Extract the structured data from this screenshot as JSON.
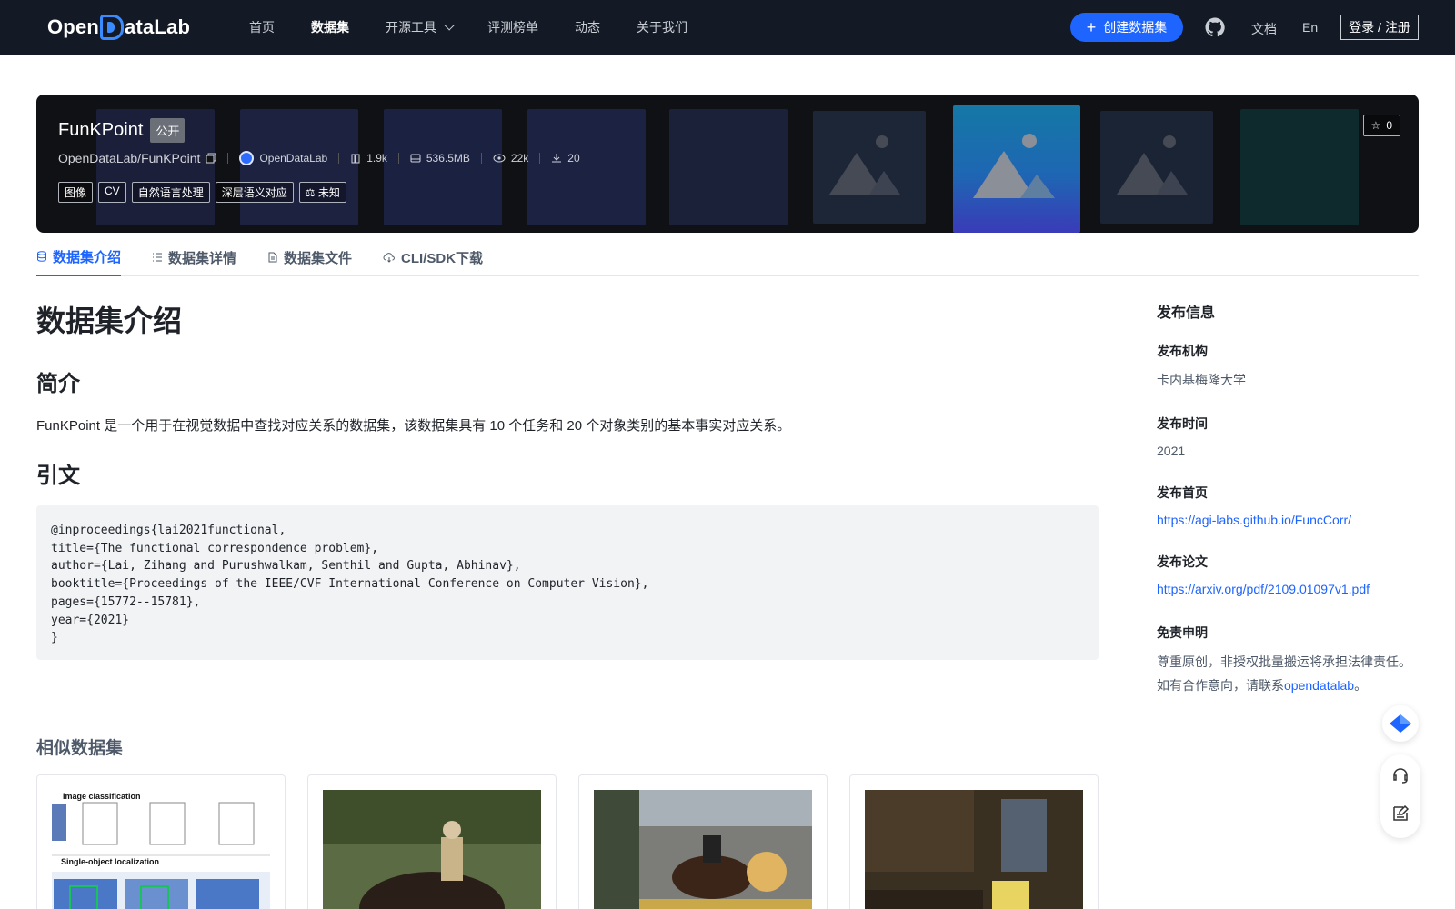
{
  "nav": {
    "logo_text_left": "Open",
    "logo_text_right": "ataLab",
    "links": [
      "首页",
      "数据集",
      "开源工具",
      "评测榜单",
      "动态",
      "关于我们"
    ],
    "create_label": "创建数据集",
    "doc_label": "文档",
    "lang_label": "En",
    "login_label": "登录 / 注册"
  },
  "dataset": {
    "name": "FunKPoint",
    "visibility": "公开",
    "path": "OpenDataLab/FunKPoint",
    "org": "OpenDataLab",
    "papers": "1.9k",
    "size": "536.5MB",
    "views": "22k",
    "downloads": "20",
    "tags": [
      "图像",
      "CV",
      "自然语言处理",
      "深层语义对应"
    ],
    "license": "未知",
    "stars": "0"
  },
  "tabs": [
    "数据集介绍",
    "数据集详情",
    "数据集文件",
    "CLI/SDK下载"
  ],
  "content": {
    "title": "数据集介绍",
    "intro_heading": "简介",
    "intro_text": "FunKPoint 是一个用于在视觉数据中查找对应关系的数据集，该数据集具有 10 个任务和 20 个对象类别的基本事实对应关系。",
    "cite_heading": "引文",
    "citation": "@inproceedings{lai2021functional,\ntitle={The functional correspondence problem},\nauthor={Lai, Zihang and Purushwalkam, Senthil and Gupta, Abhinav},\nbooktitle={Proceedings of the IEEE/CVF International Conference on Computer Vision},\npages={15772--15781},\nyear={2021}\n}"
  },
  "side": {
    "title": "发布信息",
    "org_label": "发布机构",
    "org_value": "卡内基梅隆大学",
    "time_label": "发布时间",
    "time_value": "2021",
    "home_label": "发布首页",
    "home_value": "https://agi-labs.github.io/FuncCorr/",
    "paper_label": "发布论文",
    "paper_value": "https://arxiv.org/pdf/2109.01097v1.pdf",
    "disclaimer_label": "免责申明",
    "disclaimer_line1": "尊重原创，非授权批量搬运将承担法律责任。",
    "disclaimer_line2_prefix": "如有合作意向，请联系",
    "disclaimer_link": "opendatalab",
    "disclaimer_line2_suffix": "。"
  },
  "similar": {
    "heading": "相似数据集",
    "card1_text_a": "Image classification",
    "card1_text_b": "Single-object localization"
  },
  "colors": {
    "accent": "#1e64ff",
    "nav_bg": "#141a25"
  }
}
